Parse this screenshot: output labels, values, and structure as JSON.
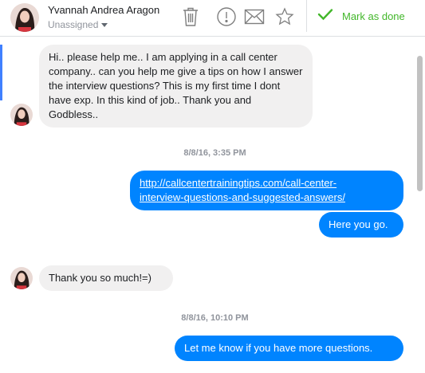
{
  "header": {
    "contact_name": "Yvannah Andrea Aragon",
    "assignee": "Unassigned",
    "mark_done_label": "Mark as done"
  },
  "icons": {
    "trash": "trash-icon",
    "spam": "alert-circle-icon",
    "unread": "envelope-icon",
    "star": "star-icon",
    "done": "checkmark-icon"
  },
  "colors": {
    "accent": "#0084ff",
    "done_green": "#42b72a",
    "incoming_bubble": "#f1f0f0"
  },
  "messages": [
    {
      "sender": "contact",
      "text": "Hi.. please help me.. I am applying in a call center company.. can you help me give a tips on how I answer the interview questions? This is my first time I dont have exp. In this kind of job.. Thank you and Godbless.."
    },
    {
      "timestamp": "8/8/16, 3:35 PM"
    },
    {
      "sender": "page",
      "link": "http://callcentertrainingtips.com/call-center-interview-questions-and-suggested-answers/",
      "link_line1": "http://callcentertrainingtips.com/call-center-",
      "link_line2": "interview-questions-and-suggested-answers/"
    },
    {
      "sender": "page",
      "text": "Here you go."
    },
    {
      "sender": "contact",
      "text": "Thank you so much!=)"
    },
    {
      "timestamp": "8/8/16, 10:10 PM"
    },
    {
      "sender": "page",
      "text": "Let me know if you have more questions."
    }
  ]
}
